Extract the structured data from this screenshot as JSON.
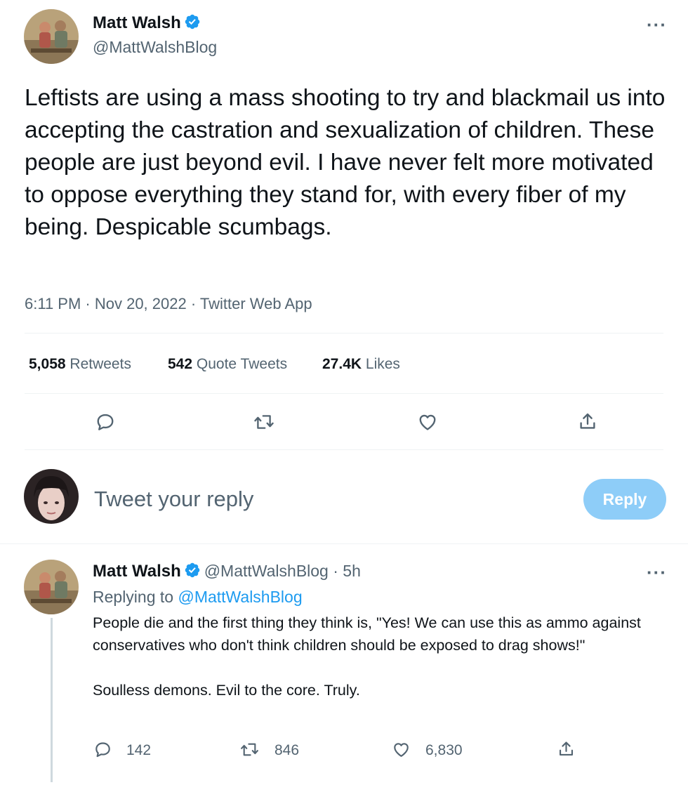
{
  "main_tweet": {
    "author_name": "Matt Walsh",
    "handle": "@MattWalshBlog",
    "more_label": "···",
    "text": "Leftists are using a mass shooting to try and blackmail us into accepting the castration and sexualization of children. These people are just beyond evil. I have never felt more motivated to oppose everything they stand for, with every fiber of my being. Despicable scumbags.",
    "meta": "6:11 PM · Nov 20, 2022 · Twitter Web App",
    "stats": {
      "retweets_count": "5,058",
      "retweets_label": "Retweets",
      "quotes_count": "542",
      "quotes_label": "Quote Tweets",
      "likes_count": "27.4K",
      "likes_label": "Likes"
    },
    "actions": [
      "reply-icon",
      "retweet-icon",
      "like-icon",
      "share-icon"
    ]
  },
  "composer": {
    "placeholder": "Tweet your reply",
    "button_label": "Reply"
  },
  "reply_tweet": {
    "author_name": "Matt Walsh",
    "handle_time": "@MattWalshBlog · 5h",
    "more_label": "···",
    "replying_prefix": "Replying to",
    "replying_to": "@MattWalshBlog",
    "text": "People die and the first thing they think is, \"Yes! We can use this as ammo against conservatives who don't think children should be exposed to drag shows!\"\n\nSoulless demons. Evil to the core. Truly.",
    "counts": {
      "replies": "142",
      "retweets": "846",
      "likes": "6,830"
    }
  },
  "colors": {
    "brand_blue": "#1d9bf0",
    "reply_button_disabled": "#8ecdf8",
    "secondary_text": "#536471",
    "divider": "#eff3f4"
  }
}
